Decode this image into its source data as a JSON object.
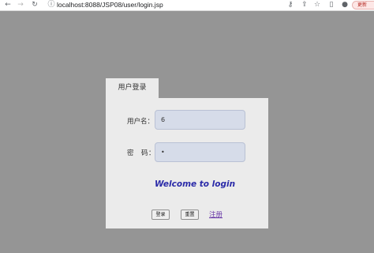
{
  "browser": {
    "url": "localhost:8088/JSP08/user/login.jsp",
    "update_label": "更新",
    "icons": [
      "back-icon",
      "forward-icon",
      "reload-icon",
      "site-info-icon",
      "key-icon",
      "share-icon",
      "star-icon",
      "side-panel-icon",
      "profile-icon"
    ]
  },
  "tab": {
    "label": "用户登录"
  },
  "form": {
    "username_label": "用户名：",
    "username_value": "6",
    "password_label": "密　码：",
    "password_value": "•",
    "welcome": "Welcome to login",
    "login_label": "登录",
    "reset_label": "重置",
    "register_label": "注册"
  },
  "colors": {
    "page_bg": "#959595",
    "panel_bg": "#ebebeb",
    "input_bg": "#d6dce9",
    "welcome": "#2a2aa8",
    "link": "#6a3aa8"
  }
}
